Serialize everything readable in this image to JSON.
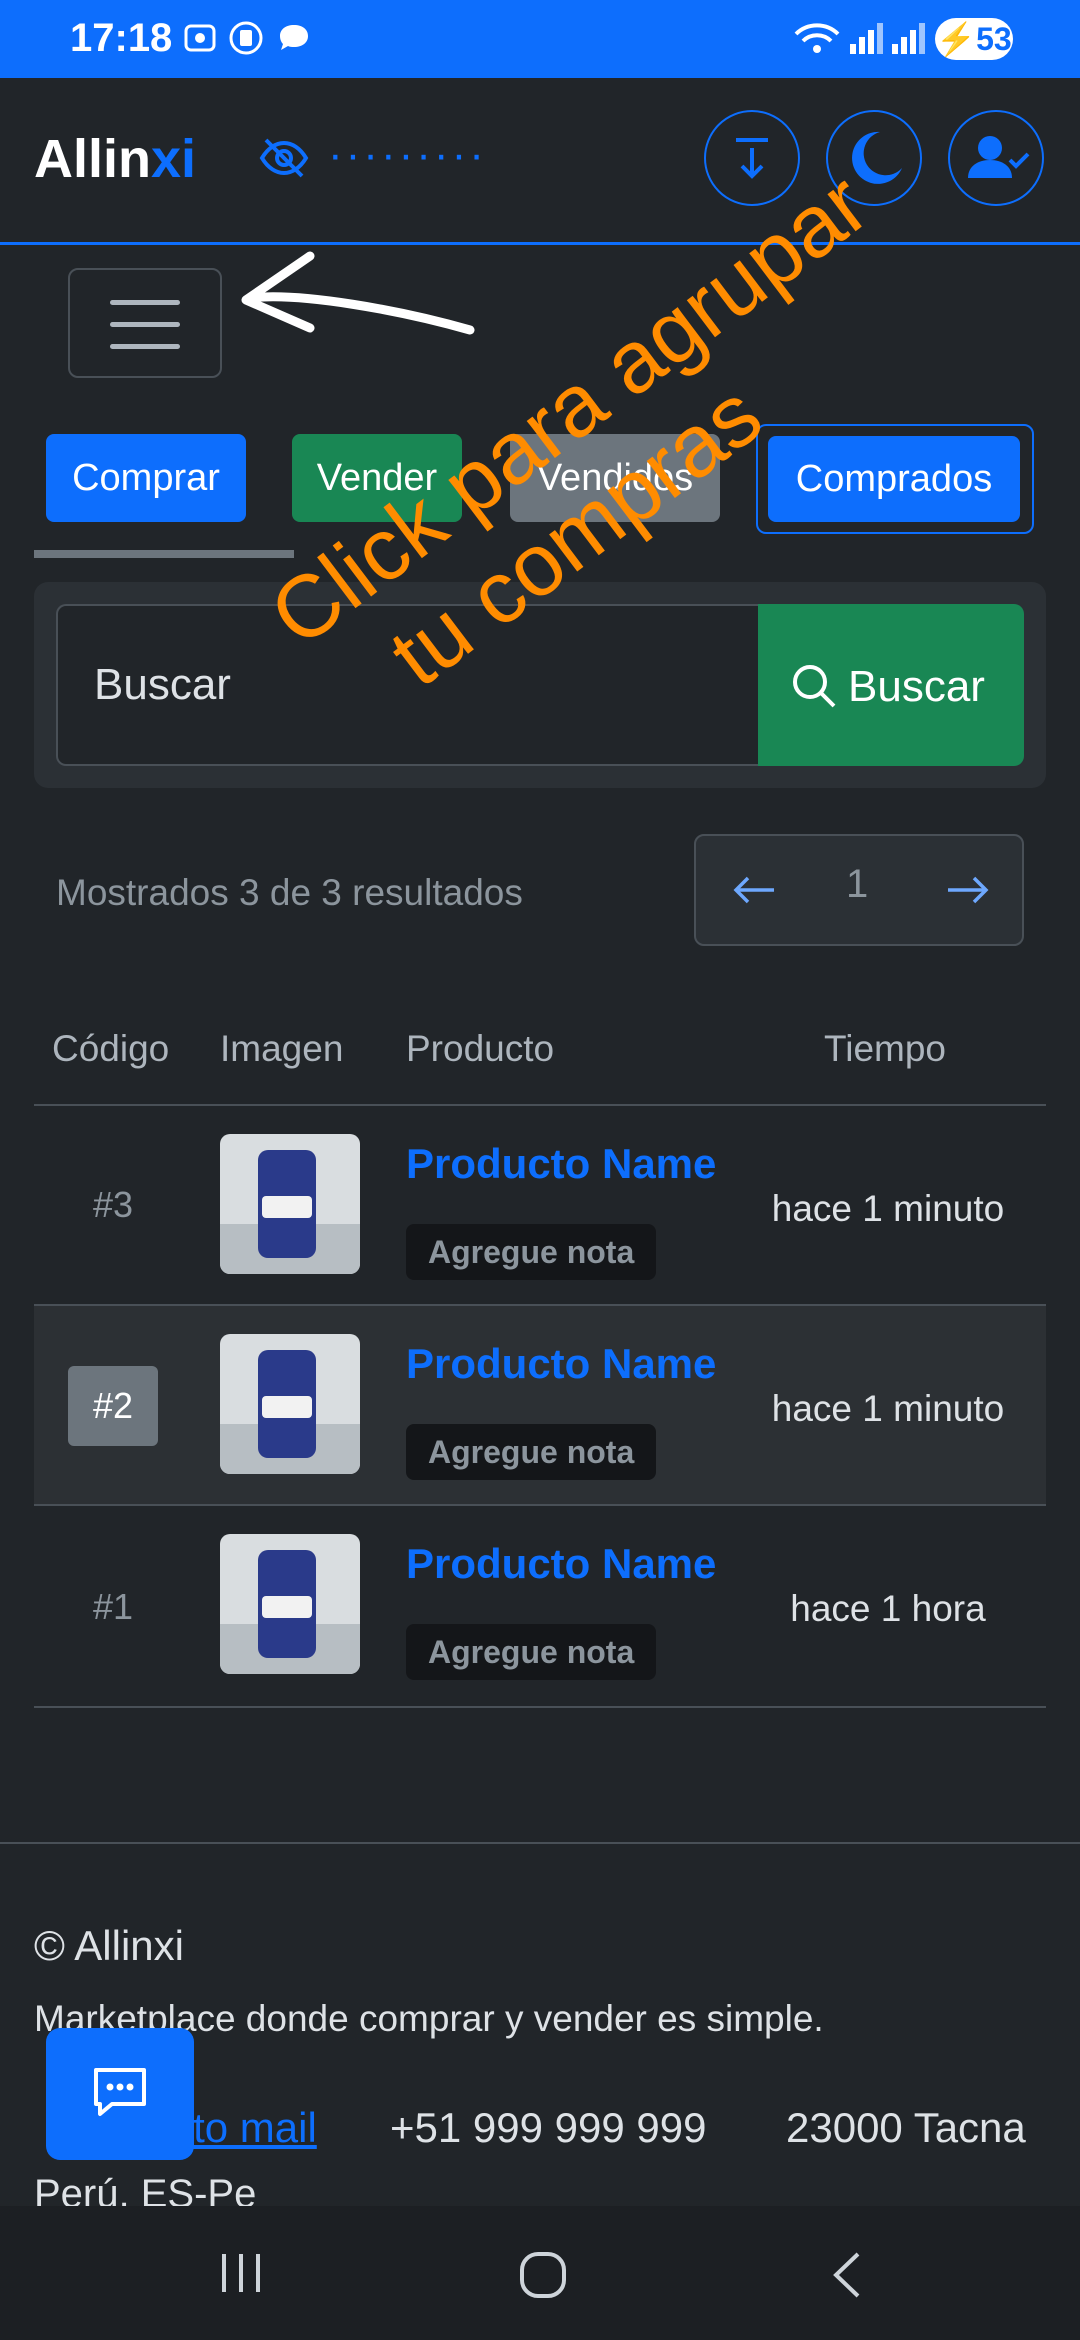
{
  "status_bar": {
    "time": "17:18",
    "battery": "53"
  },
  "navbar": {
    "brand_main": "Allin",
    "brand_accent": "xi",
    "privacy_mask": "·········"
  },
  "tabs": [
    {
      "label": "Comprar",
      "color": "#0d6efd"
    },
    {
      "label": "Vender",
      "color": "#198754"
    },
    {
      "label": "Vendidos",
      "color": "#6c757d"
    },
    {
      "label": "Comprados",
      "color": "#0d6efd"
    }
  ],
  "search": {
    "placeholder": "Buscar",
    "button_label": "Buscar"
  },
  "results": {
    "summary": "Mostrados 3 de 3 resultados",
    "current_page": "1"
  },
  "table": {
    "headers": {
      "code": "Código",
      "image": "Imagen",
      "product": "Producto",
      "time": "Tiempo"
    },
    "rows": [
      {
        "code": "#3",
        "name": "Producto Name",
        "note": "Agregue nota",
        "time": "hace 1 minuto"
      },
      {
        "code": "#2",
        "name": "Producto Name",
        "note": "Agregue nota",
        "time": "hace 1 minuto"
      },
      {
        "code": "#1",
        "name": "Producto Name",
        "note": "Agregue nota",
        "time": "hace 1 hora"
      }
    ]
  },
  "footer": {
    "copyright": "© Allinxi",
    "tagline": "Marketplace donde comprar y vender es simple.",
    "mail": "Contacto mail",
    "phone": "+51 999 999 999",
    "city": "23000 Tacna",
    "country": "Perú, ES-Pe"
  },
  "annotation": {
    "line1": "Click para agrupar",
    "line2": "tu compras",
    "color": "#ff8c00"
  }
}
